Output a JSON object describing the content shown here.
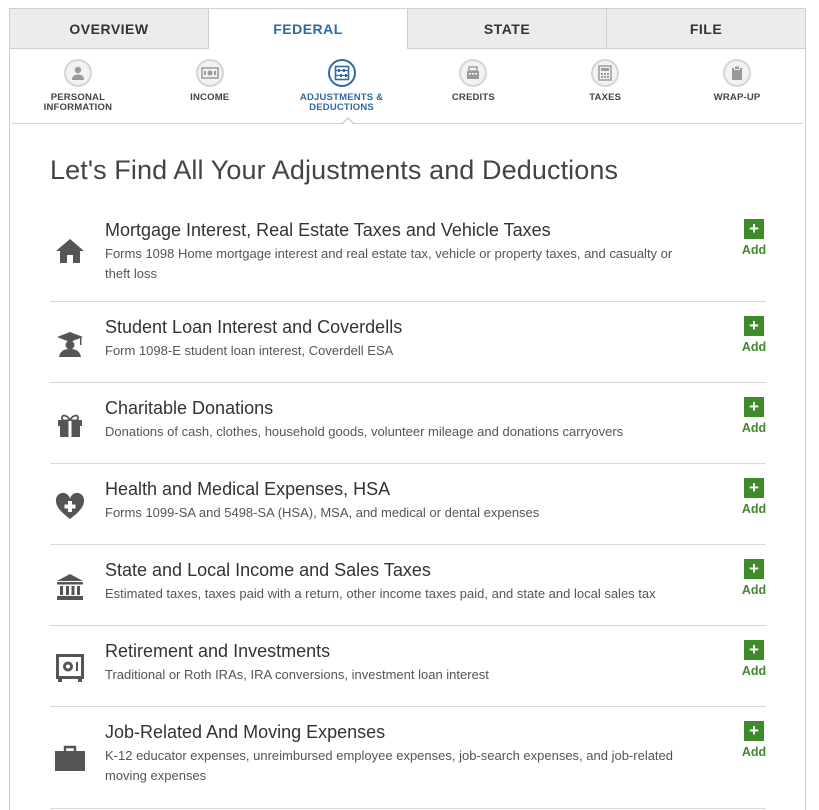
{
  "tabs": [
    {
      "label": "OVERVIEW",
      "active": false
    },
    {
      "label": "FEDERAL",
      "active": true
    },
    {
      "label": "STATE",
      "active": false
    },
    {
      "label": "FILE",
      "active": false
    }
  ],
  "steps": [
    {
      "label1": "PERSONAL",
      "label2": "INFORMATION",
      "icon": "person-icon"
    },
    {
      "label1": "INCOME",
      "label2": "",
      "icon": "money-icon"
    },
    {
      "label1": "ADJUSTMENTS &",
      "label2": "DEDUCTIONS",
      "icon": "abacus-icon"
    },
    {
      "label1": "CREDITS",
      "label2": "",
      "icon": "cash-register-icon"
    },
    {
      "label1": "TAXES",
      "label2": "",
      "icon": "calculator-icon"
    },
    {
      "label1": "WRAP-UP",
      "label2": "",
      "icon": "clipboard-icon"
    }
  ],
  "page_title": "Let's Find All Your Adjustments and Deductions",
  "add_label": "Add",
  "add_symbol": "+",
  "categories": [
    {
      "title": "Mortgage Interest, Real Estate Taxes and Vehicle Taxes",
      "description": "Forms 1098 Home mortgage interest and real estate tax, vehicle or property taxes, and casualty or theft loss",
      "icon": "house-icon"
    },
    {
      "title": "Student Loan Interest and Coverdells",
      "description": "Form 1098-E student loan interest, Coverdell ESA",
      "icon": "graduation-cap-icon"
    },
    {
      "title": "Charitable Donations",
      "description": "Donations of cash, clothes, household goods, volunteer mileage and donations carryovers",
      "icon": "gift-icon"
    },
    {
      "title": "Health and Medical Expenses, HSA",
      "description": "Forms 1099-SA and 5498-SA (HSA), MSA, and medical or dental expenses",
      "icon": "medical-heart-icon"
    },
    {
      "title": "State and Local Income and Sales Taxes",
      "description": "Estimated taxes, taxes paid with a return, other income taxes paid, and state and local sales tax",
      "icon": "government-building-icon"
    },
    {
      "title": "Retirement and Investments",
      "description": "Traditional or Roth IRAs, IRA conversions, investment loan interest",
      "icon": "safe-icon"
    },
    {
      "title": "Job-Related And Moving Expenses",
      "description": "K-12 educator expenses, unreimbursed employee expenses, job-search expenses, and job-related moving expenses",
      "icon": "briefcase-icon"
    }
  ],
  "colors": {
    "accent": "#2f6aa0",
    "add_green": "#3f8a2b",
    "icon_gray": "#555555"
  }
}
